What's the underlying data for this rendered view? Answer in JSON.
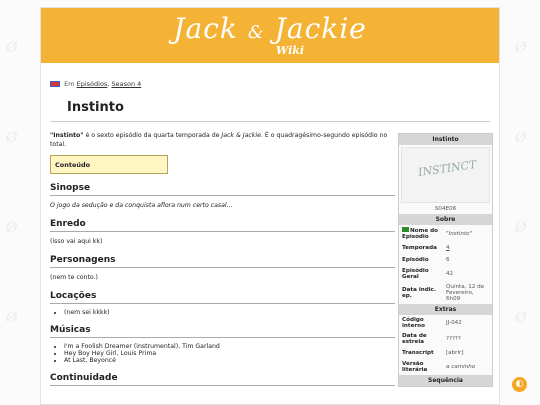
{
  "header": {
    "logo_main": "Jack",
    "logo_amp": "&",
    "logo_second": "Jackie",
    "logo_wiki": "Wiki"
  },
  "breadcrumb": {
    "prefix": "Em",
    "link1": "Episódios",
    "sep": ",",
    "link2": "Season 4"
  },
  "page": {
    "title": "Instinto"
  },
  "intro": {
    "bold": "\"Instinto\"",
    "text1": " é o sexto episódio da quarta temporada de ",
    "italic": "Jack & Jackie",
    "text2": ". É o quadragésimo-segundo episódio no total."
  },
  "toc": {
    "label": "Conteúdo"
  },
  "sections": {
    "sinopse": {
      "heading": "Sinopse",
      "text": "O jogo da sedução e da conquista aflora num certo casal..."
    },
    "enredo": {
      "heading": "Enredo",
      "text": "(isso vai aqui kk)"
    },
    "personagens": {
      "heading": "Personagens",
      "text": "(nem te conto.)"
    },
    "locacoes": {
      "heading": "Locações",
      "items": [
        "(nem sei kkkk)"
      ]
    },
    "musicas": {
      "heading": "Músicas",
      "items": [
        "I'm a Foolish Dreamer (instrumental), Tim Garland",
        "Hey Boy Hey Girl, Louis Prima",
        "At Last, Beyoncé"
      ]
    },
    "continuidade": {
      "heading": "Continuidade"
    }
  },
  "infobox": {
    "title": "Instinto",
    "image_text": "INSTINCT",
    "caption": "S04E06",
    "sobre": "Sobre",
    "rows": [
      {
        "k": "Nome do Episódio",
        "v": "\"Instinto\""
      },
      {
        "k": "Temporada",
        "v": "4"
      },
      {
        "k": "Episódio",
        "v": "6"
      },
      {
        "k": "Episódio Geral",
        "v": "42"
      },
      {
        "k": "Data indic. ep.",
        "v": "Quinta, 12 de Fevereiro, 6h09"
      }
    ],
    "extras": "Extras",
    "extra_rows": [
      {
        "k": "Código interno",
        "v": "JJ-042"
      },
      {
        "k": "Data de estreia",
        "v": "?????"
      },
      {
        "k": "Transcript",
        "v": "[abrir]"
      },
      {
        "k": "Versão literária",
        "v": "a caminho"
      }
    ],
    "sequencia": "Sequência"
  },
  "fab_icon": "theme-toggle-icon"
}
